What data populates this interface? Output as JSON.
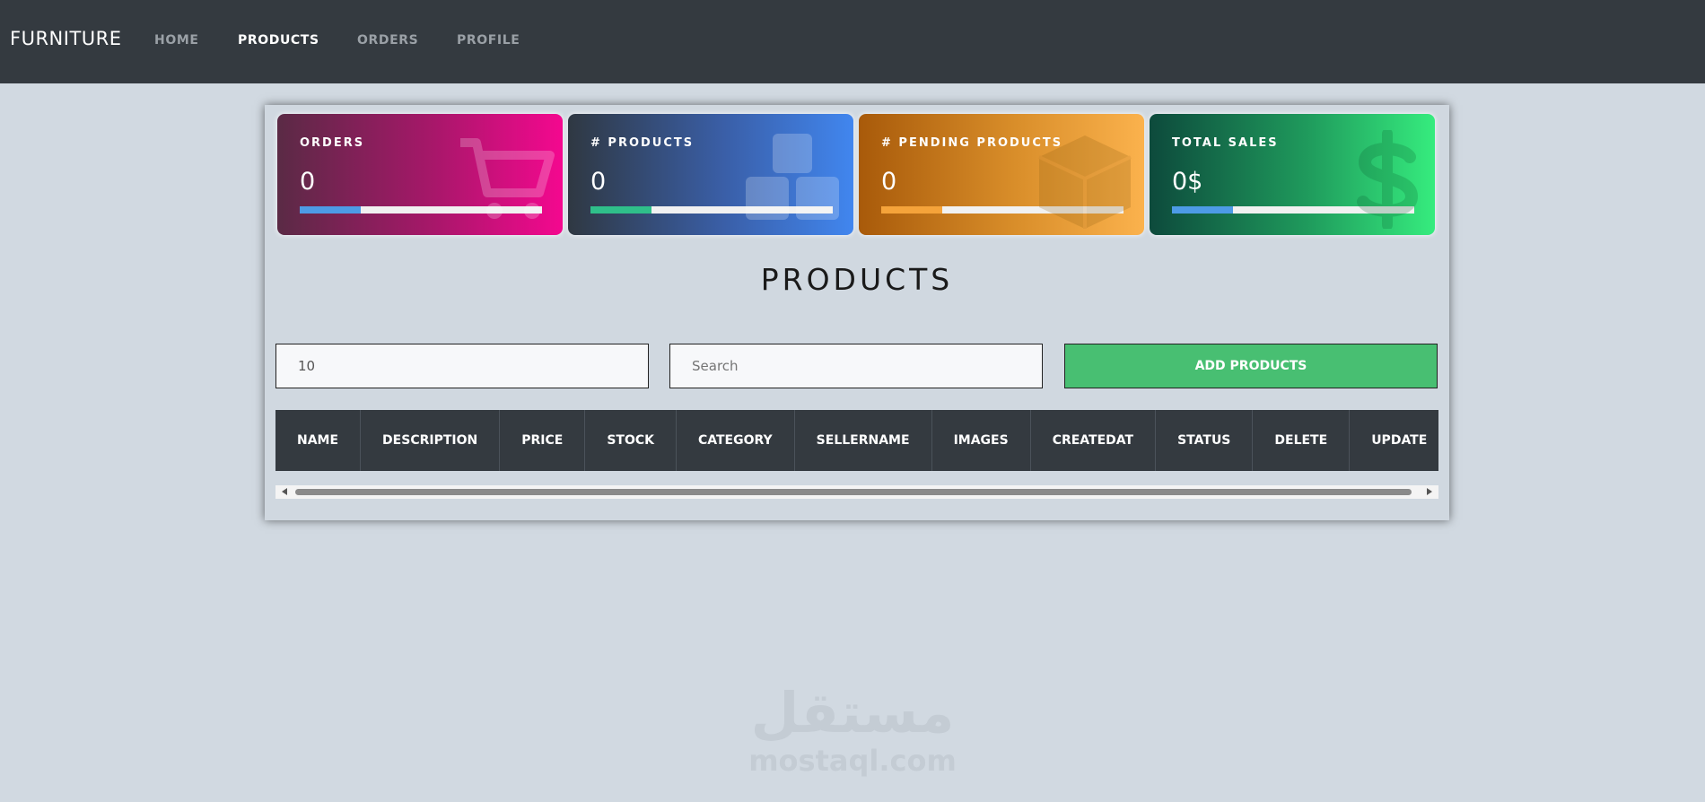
{
  "navbar": {
    "brand": "FURNITURE",
    "links": [
      {
        "label": "HOME",
        "active": false
      },
      {
        "label": "PRODUCTS",
        "active": true
      },
      {
        "label": "ORDERS",
        "active": false
      },
      {
        "label": "PROFILE",
        "active": false
      }
    ]
  },
  "cards": [
    {
      "label": "ORDERS",
      "value": "0",
      "icon": "cart-icon",
      "bar_color": "#4d9be6"
    },
    {
      "label": "# PRODUCTS",
      "value": "0",
      "icon": "cubes-icon",
      "bar_color": "#2fbf8a"
    },
    {
      "label": "# PENDING PRODUCTS",
      "value": "0",
      "icon": "box-icon",
      "bar_color": "#f5a33a"
    },
    {
      "label": "TOTAL SALES",
      "value": "0$",
      "icon": "dollar-icon",
      "bar_color": "#4d9be6"
    }
  ],
  "page_title": "PRODUCTS",
  "limit_input": {
    "value": "10"
  },
  "search_input": {
    "placeholder": "Search"
  },
  "add_button": {
    "label": "ADD PRODUCTS"
  },
  "table": {
    "columns": [
      "NAME",
      "DESCRIPTION",
      "PRICE",
      "STOCK",
      "CATEGORY",
      "SELLERNAME",
      "IMAGES",
      "CREATEDAT",
      "STATUS",
      "DELETE",
      "UPDATE"
    ]
  },
  "watermark": {
    "arabic": "مستقل",
    "latin": "mostaql.com"
  }
}
